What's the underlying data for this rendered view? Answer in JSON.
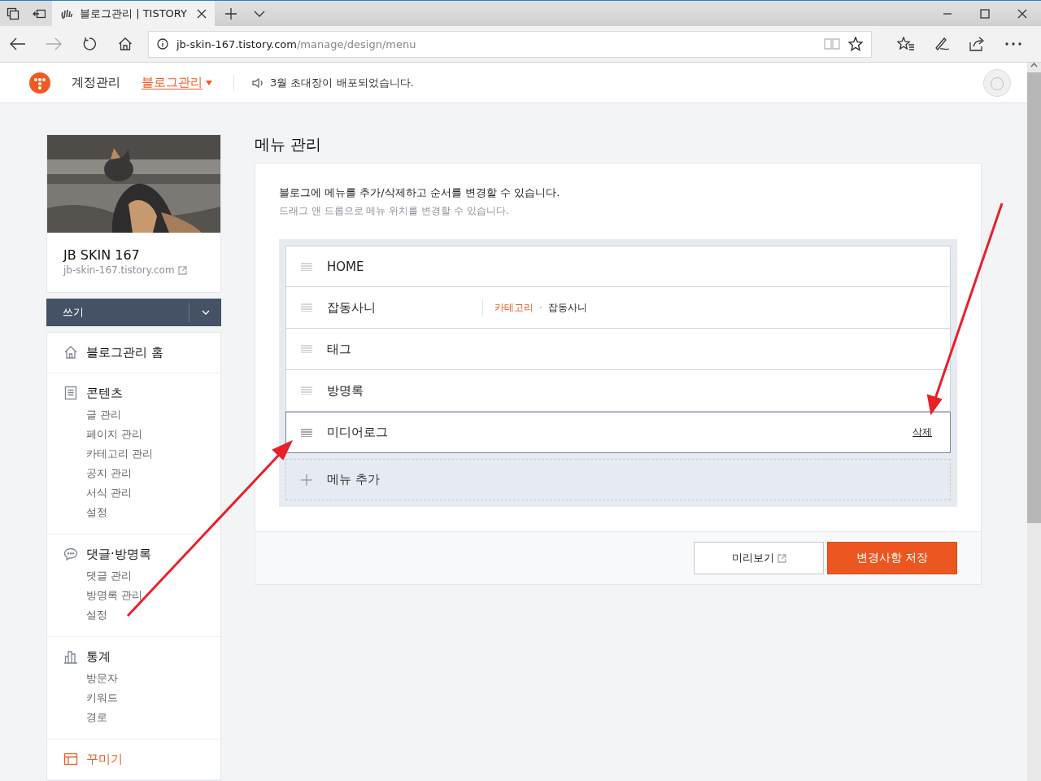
{
  "browser": {
    "tabs": [
      {
        "title": "블로그관리 | TISTORY",
        "selected": true
      }
    ],
    "url_host": "jb-skin-167.tistory.com",
    "url_path": "/manage/design/menu"
  },
  "header": {
    "nav": [
      {
        "label": "계정관리",
        "selected": false
      },
      {
        "label": "블로그관리",
        "selected": true
      }
    ],
    "notice": "3월 초대장이 배포되었습니다."
  },
  "blog": {
    "name": "JB SKIN 167",
    "url": "jb-skin-167.tistory.com"
  },
  "write_button": "쓰기",
  "sidebar": {
    "sections": [
      {
        "kind": "home",
        "title": "블로그관리 홈",
        "selected": false
      },
      {
        "kind": "document",
        "title": "콘텐츠",
        "selected": false,
        "items": [
          "글 관리",
          "페이지 관리",
          "카테고리 관리",
          "공지 관리",
          "서식 관리",
          "설정"
        ]
      },
      {
        "kind": "chat",
        "title": "댓글·방명록",
        "selected": false,
        "items": [
          "댓글 관리",
          "방명록 관리",
          "설정"
        ]
      },
      {
        "kind": "chart",
        "title": "통계",
        "selected": false,
        "items": [
          "방문자",
          "키워드",
          "경로"
        ]
      },
      {
        "kind": "layout",
        "title": "꾸미기",
        "selected": true
      }
    ]
  },
  "page_title": "메뉴 관리",
  "description": "블로그에 메뉴를 추가/삭제하고 순서를 변경할 수 있습니다.",
  "hint": "드래그 앤 드롭으로 메뉴 위치를 변경할 수 있습니다.",
  "menu_items": [
    {
      "label": "HOME",
      "selected": false
    },
    {
      "label": "잡동사니",
      "selected": false,
      "type_label": "카테고리",
      "target": "잡동사니"
    },
    {
      "label": "태그",
      "selected": false
    },
    {
      "label": "방명록",
      "selected": false
    },
    {
      "label": "미디어로그",
      "selected": true,
      "action": "삭제"
    }
  ],
  "add_menu": "메뉴 추가",
  "buttons": {
    "preview": "미리보기",
    "save": "변경사항 저장"
  }
}
